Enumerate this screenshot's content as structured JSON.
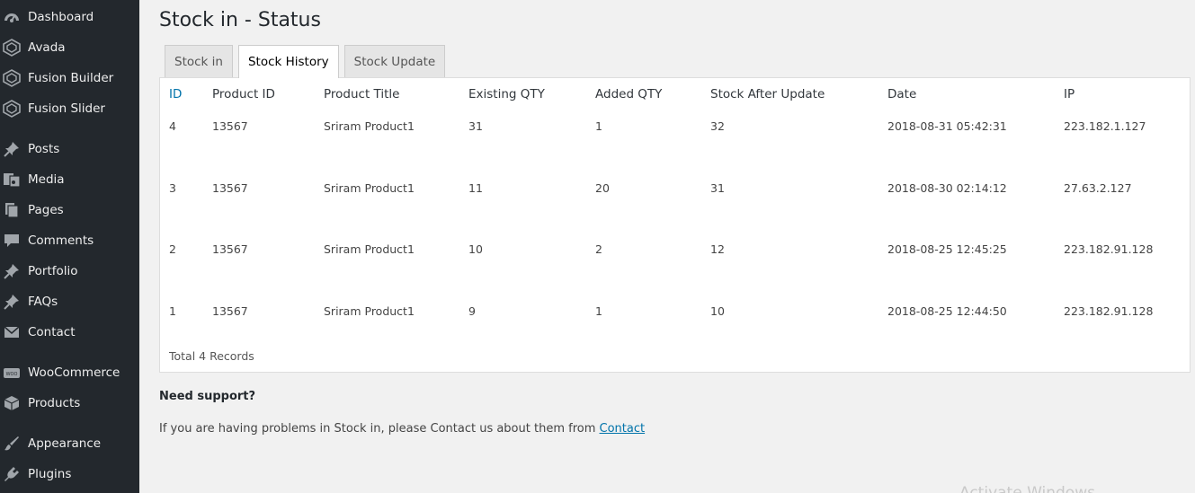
{
  "sidebar": {
    "items": [
      {
        "label": "Dashboard",
        "icon": "dashboard-icon"
      },
      {
        "label": "Avada",
        "icon": "avada-icon"
      },
      {
        "label": "Fusion Builder",
        "icon": "fusion-builder-icon"
      },
      {
        "label": "Fusion Slider",
        "icon": "fusion-slider-icon"
      },
      {
        "label": "Posts",
        "icon": "pin-icon"
      },
      {
        "label": "Media",
        "icon": "media-icon"
      },
      {
        "label": "Pages",
        "icon": "pages-icon"
      },
      {
        "label": "Comments",
        "icon": "comment-icon"
      },
      {
        "label": "Portfolio",
        "icon": "pin-icon"
      },
      {
        "label": "FAQs",
        "icon": "pin-icon"
      },
      {
        "label": "Contact",
        "icon": "envelope-icon"
      },
      {
        "label": "WooCommerce",
        "icon": "woocommerce-icon"
      },
      {
        "label": "Products",
        "icon": "box-icon"
      },
      {
        "label": "Appearance",
        "icon": "brush-icon"
      },
      {
        "label": "Plugins",
        "icon": "plug-icon"
      }
    ]
  },
  "page": {
    "title": "Stock in - Status"
  },
  "tabs": [
    {
      "label": "Stock in"
    },
    {
      "label": "Stock History"
    },
    {
      "label": "Stock Update"
    }
  ],
  "table": {
    "headers": [
      "ID",
      "Product ID",
      "Product Title",
      "Existing QTY",
      "Added QTY",
      "Stock After Update",
      "Date",
      "IP"
    ],
    "rows": [
      [
        "4",
        "13567",
        "Sriram Product1",
        "31",
        "1",
        "32",
        "2018-08-31 05:42:31",
        "223.182.1.127"
      ],
      [
        "3",
        "13567",
        "Sriram Product1",
        "11",
        "20",
        "31",
        "2018-08-30 02:14:12",
        "27.63.2.127"
      ],
      [
        "2",
        "13567",
        "Sriram Product1",
        "10",
        "2",
        "12",
        "2018-08-25 12:45:25",
        "223.182.91.128"
      ],
      [
        "1",
        "13567",
        "Sriram Product1",
        "9",
        "1",
        "10",
        "2018-08-25 12:44:50",
        "223.182.91.128"
      ]
    ],
    "total": "Total 4 Records"
  },
  "support": {
    "title": "Need support?",
    "text": "If you are having problems in Stock in, please Contact us about them from",
    "link": "Contact"
  },
  "watermark": "Activate Windows",
  "colors": {
    "sidebar_bg": "#23282d",
    "link": "#0073aa",
    "page_bg": "#f1f1f1"
  }
}
